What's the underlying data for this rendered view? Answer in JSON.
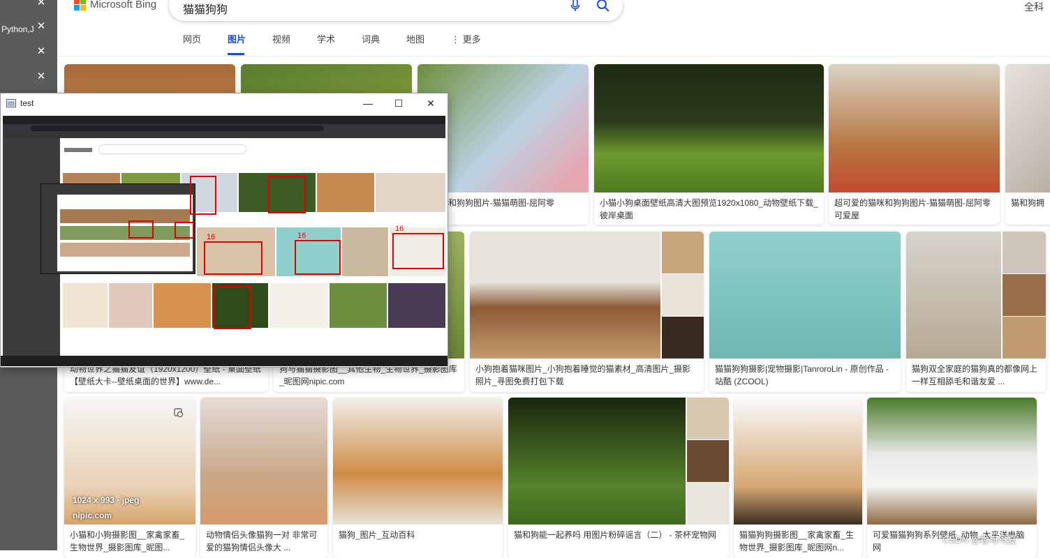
{
  "sidebar": {
    "items": [
      {
        "label": ""
      },
      {
        "label": "Python,J"
      },
      {
        "label": ""
      },
      {
        "label": ""
      }
    ],
    "close_glyph": "✕"
  },
  "browser": {
    "logo_text": "Microsoft Bing",
    "logo_colors": [
      "#f25022",
      "#7fba00",
      "#00a4ef",
      "#ffb900"
    ],
    "query": "猫猫狗狗",
    "locale": "全科",
    "tabs": [
      {
        "label": "网页",
        "active": false
      },
      {
        "label": "图片",
        "active": true
      },
      {
        "label": "视频",
        "active": false
      },
      {
        "label": "学术",
        "active": false
      },
      {
        "label": "词典",
        "active": false
      },
      {
        "label": "地图",
        "active": false
      }
    ],
    "more_label": "⋮ 更多",
    "accent": "#174ae4"
  },
  "results": {
    "row1": [
      {
        "caption": ""
      },
      {
        "caption": ""
      },
      {
        "caption": "的猫咪和狗狗图片-猫猫萌图-屈阿零"
      },
      {
        "caption": "小猫小狗桌面壁纸高清大图预览1920x1080_动物壁纸下载_彼岸桌面"
      },
      {
        "caption": "超可爱的猫咪和狗狗图片-猫猫萌图-屈阿零可爱屋"
      },
      {
        "caption": "猫和狗拥"
      }
    ],
    "row2": [
      {
        "caption": "动物世界之猫猫友谊（1920x1200）壁纸 - 桌面壁纸【壁纸大卡--壁纸桌面的世界】www.de..."
      },
      {
        "caption": "狗与猫猫摄影图__其他生物_生物世界_摄影图库_昵图网nipic.com"
      },
      {
        "caption": "小狗抱着猫咪图片_小狗抱着睡觉的猫素材_高清图片_摄影照片_寻图免费打包下载"
      },
      {
        "caption": "猫猫狗狗摄影|宠物摄影|TanroroLin - 原创作品 - 站酷 (ZCOOL)"
      },
      {
        "caption": "猫狗双全家庭的猫狗真的都像网上一样互相舔毛和谐友爱 ..."
      }
    ],
    "row3": [
      {
        "caption": "小猫和小狗摄影图__家禽家畜_生物世界_摄影图库_昵图...",
        "size": "1024 x 993 · jpeg",
        "source": "nipic.com"
      },
      {
        "caption": "动物情侣头像猫狗一对 非常可爱的猫狗情侣头像大 ..."
      },
      {
        "caption": "猫狗_图片_互动百科"
      },
      {
        "caption": "猫和狗能一起养吗 用图片粉碎谣言（二） - 茶杯宠物网"
      },
      {
        "caption": "猫猫狗狗摄影图__家禽家畜_生物世界_摄影图库_昵图网n..."
      },
      {
        "caption": "可爱猫猫狗狗系列壁纸_动物_太平洋电脑网"
      }
    ]
  },
  "overlay": {
    "title": "test",
    "min_glyph": "—",
    "max_glyph": "☐",
    "close_glyph": "✕",
    "labels": [
      "16",
      "16",
      "16",
      "16",
      "16",
      "16"
    ]
  },
  "watermark": "CSDN @香与鸟夏"
}
